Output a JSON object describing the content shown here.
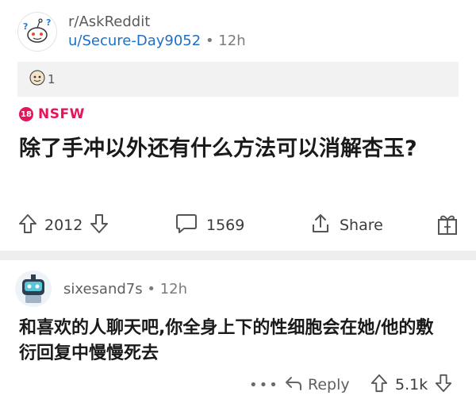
{
  "post": {
    "subreddit": "r/AskReddit",
    "username": "u/Secure-Day9052",
    "separator": "•",
    "time": "12h",
    "award_count": "1",
    "nsfw_badge": "18",
    "nsfw_label": "NSFW",
    "title": "除了手冲以外还有什么方法可以消解杏玉?",
    "upvotes": "2012",
    "comments": "1569",
    "share_label": "Share"
  },
  "comment": {
    "username": "sixesand7s",
    "separator": "•",
    "time": "12h",
    "body": "和喜欢的人聊天吧,你全身上下的性细胞会在她/他的敷衍回复中慢慢死去",
    "more": "•••",
    "reply_label": "Reply",
    "votes": "5.1k"
  },
  "colors": {
    "link_blue": "#1d6fc7",
    "nsfw_pink": "#e5145b",
    "divider_gray": "#eeeeee"
  },
  "icons": [
    "askreddit-avatar-icon",
    "award-icon",
    "upvote-icon",
    "downvote-icon",
    "comment-bubble-icon",
    "share-icon",
    "gift-icon",
    "robot-avatar-icon",
    "reply-arrow-icon"
  ]
}
